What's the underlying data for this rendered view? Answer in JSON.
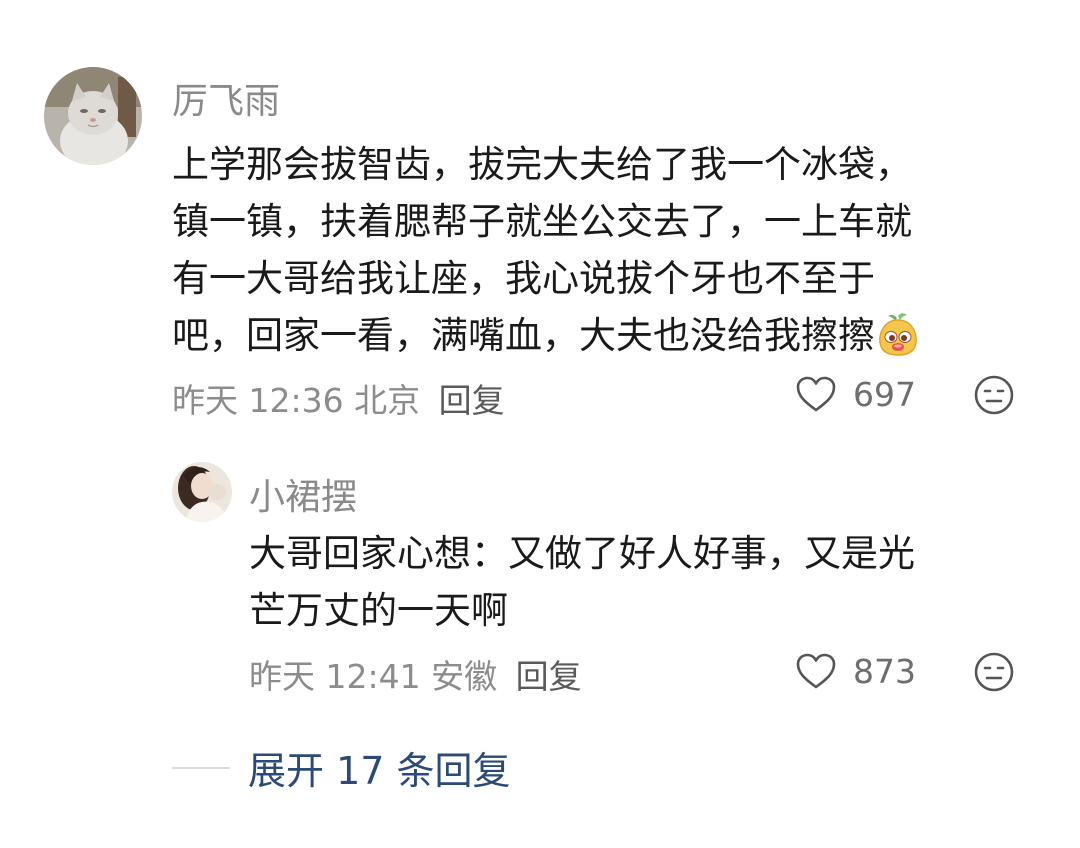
{
  "comments": [
    {
      "author": "厉飞雨",
      "avatar_icon": "cat-avatar",
      "lines": [
        "上学那会拔智齿，拔完大夫给了我一个冰袋，",
        "镇一镇，扶着腮帮子就坐公交去了，一上车就",
        "有一大哥给我让座，我心说拔个牙也不至于",
        "吧，回家一看，满嘴血，大夫也没给我擦擦"
      ],
      "trailing_emoji": "face-emoji",
      "time": "昨天 12:36 北京",
      "reply_label": "回复",
      "likes": "697",
      "reply": {
        "author": "小裙摆",
        "avatar_icon": "girl-avatar",
        "lines": [
          "大哥回家心想：又做了好人好事，又是光",
          "芒万丈的一天啊"
        ],
        "time": "昨天 12:41 安徽",
        "reply_label": "回复",
        "likes": "873"
      }
    }
  ],
  "expand": {
    "label": "展开 17 条回复"
  },
  "colors": {
    "name_gray": "#8a8a8a",
    "text_black": "#1a1a1a",
    "meta_gray": "#8c8c8c",
    "link_blue": "#2b4a77"
  }
}
